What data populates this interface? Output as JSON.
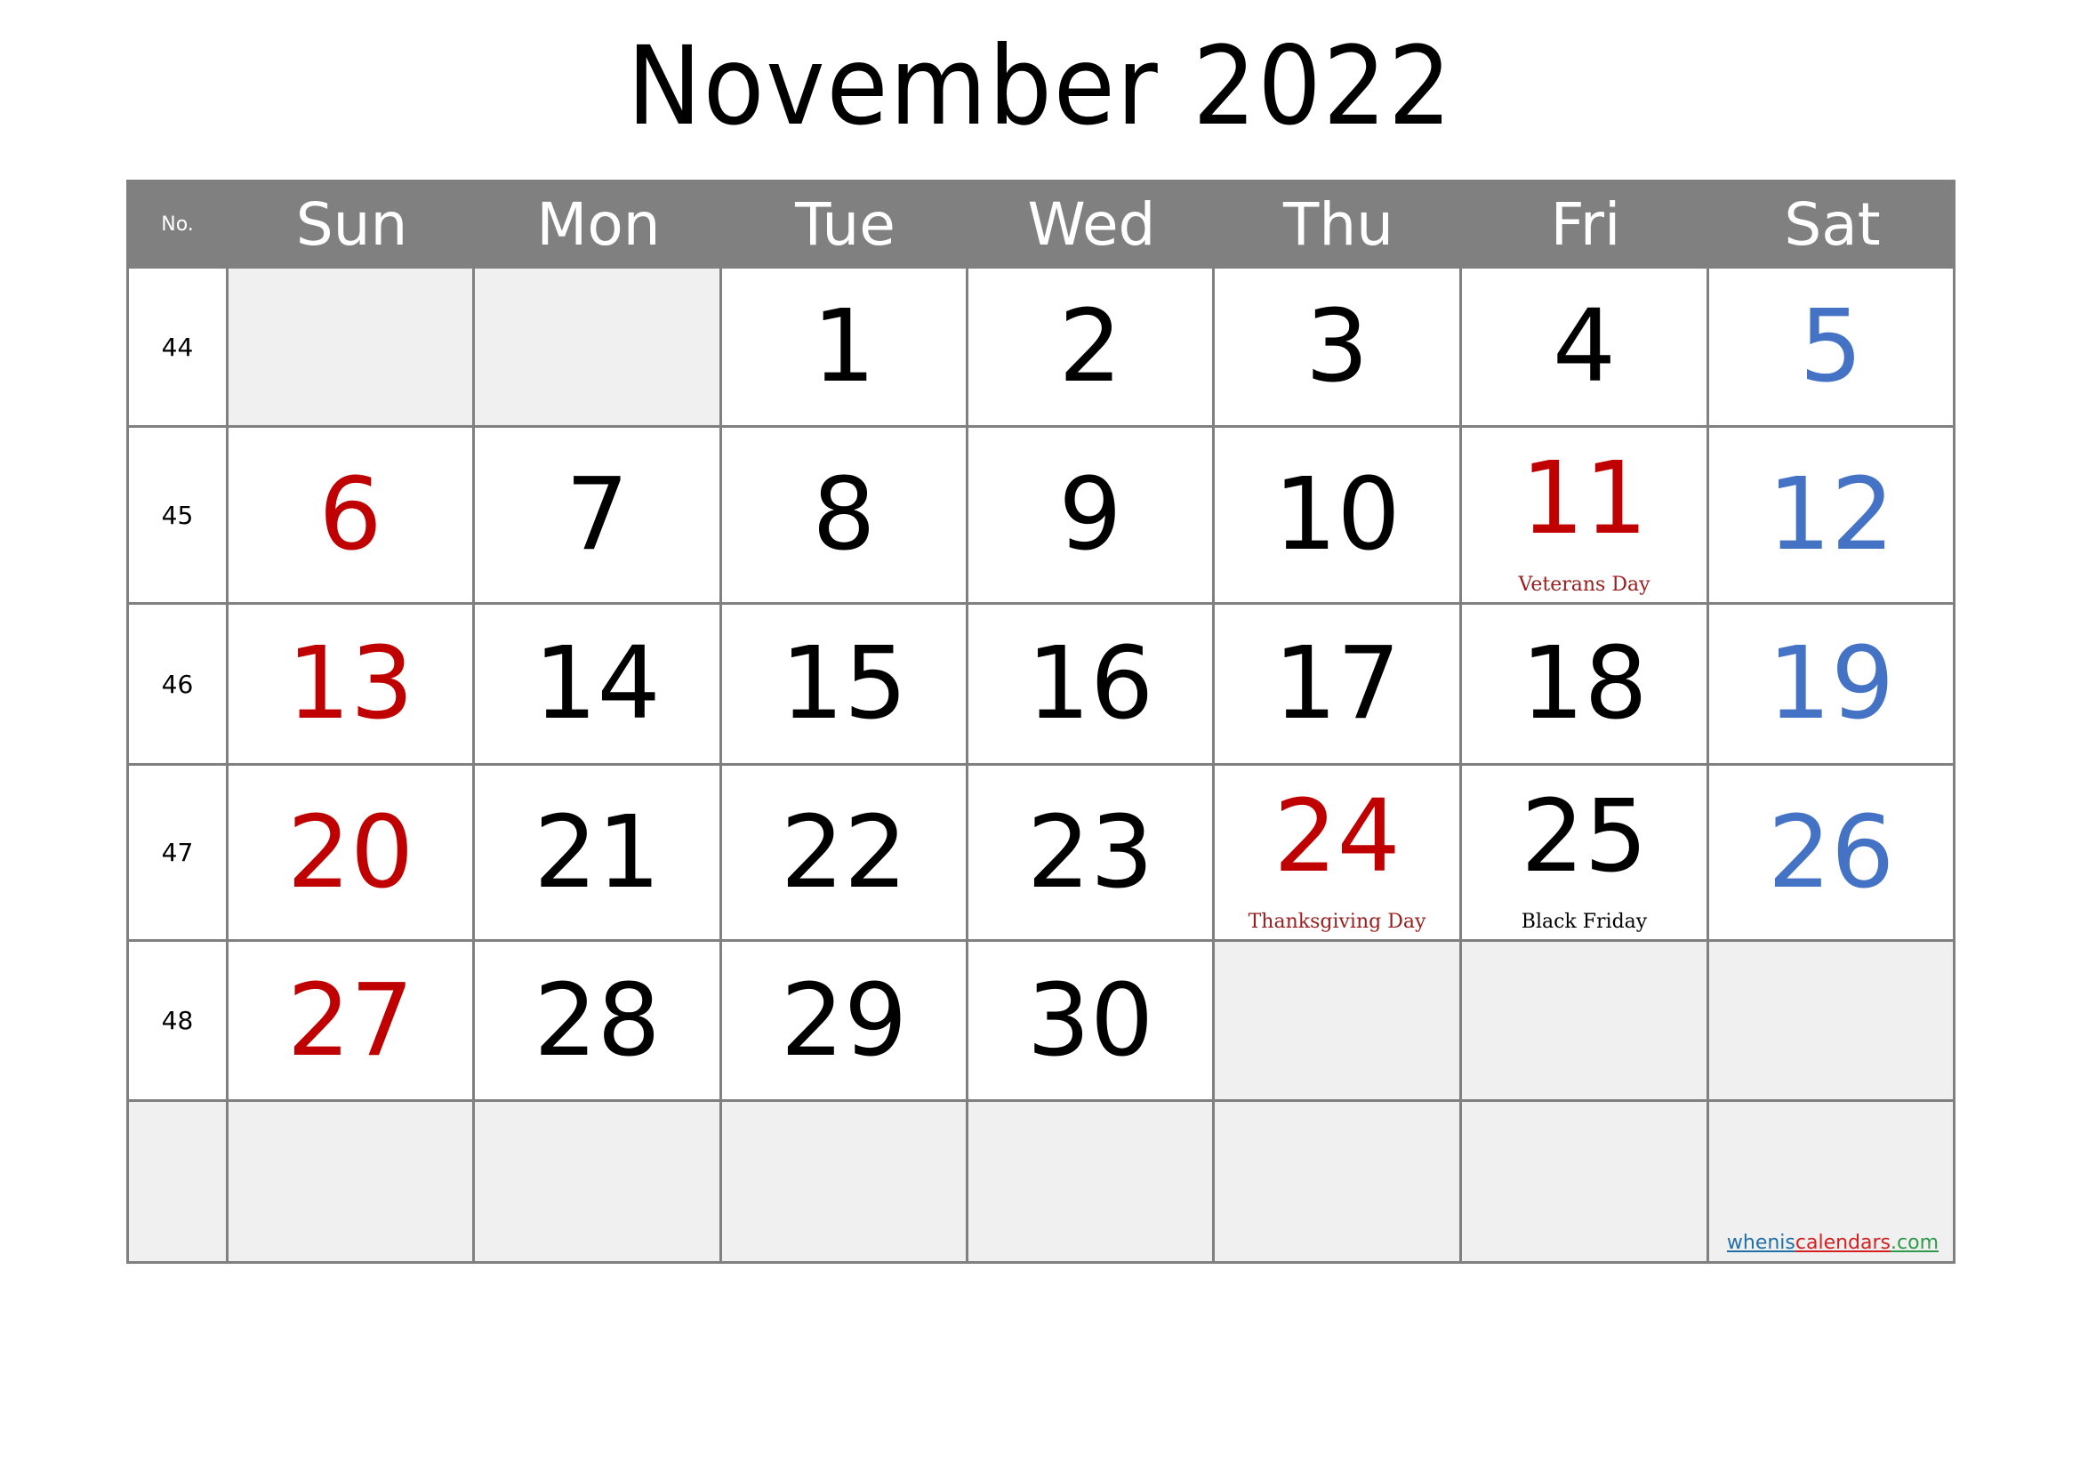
{
  "title": "November 2022",
  "header": {
    "week_no_label": "No.",
    "days": [
      "Sun",
      "Mon",
      "Tue",
      "Wed",
      "Thu",
      "Fri",
      "Sat"
    ]
  },
  "colors": {
    "header_bg": "#808080",
    "header_text": "#ffffff",
    "empty_cell": "#f0f0f0",
    "grid_line": "#808080",
    "sunday": "#c00000",
    "saturday": "#4472c4",
    "holiday": "#c00000",
    "holiday_label": "#9b1c1c",
    "regular": "#000000"
  },
  "weeks": [
    {
      "no": "44",
      "days": [
        "",
        "",
        "1",
        "2",
        "3",
        "4",
        "5"
      ]
    },
    {
      "no": "45",
      "days": [
        "6",
        "7",
        "8",
        "9",
        "10",
        "11",
        "12"
      ]
    },
    {
      "no": "46",
      "days": [
        "13",
        "14",
        "15",
        "16",
        "17",
        "18",
        "19"
      ]
    },
    {
      "no": "47",
      "days": [
        "20",
        "21",
        "22",
        "23",
        "24",
        "25",
        "26"
      ]
    },
    {
      "no": "48",
      "days": [
        "27",
        "28",
        "29",
        "30",
        "",
        "",
        ""
      ]
    },
    {
      "no": "",
      "days": [
        "",
        "",
        "",
        "",
        "",
        "",
        ""
      ]
    }
  ],
  "holidays": [
    {
      "day": "11",
      "label": "Veterans Day",
      "label_color": "#9b1c1c",
      "day_color": "#c00000"
    },
    {
      "day": "24",
      "label": "Thanksgiving Day",
      "label_color": "#9b1c1c",
      "day_color": "#c00000"
    },
    {
      "day": "25",
      "label": "Black Friday",
      "label_color": "#000000",
      "day_color": "#000000"
    }
  ],
  "watermark": {
    "parts": [
      {
        "text": "whenis",
        "color": "#1f6fa8"
      },
      {
        "text": "calendars",
        "color": "#d42020"
      },
      {
        "text": ".com",
        "color": "#2e9a4a"
      }
    ]
  }
}
